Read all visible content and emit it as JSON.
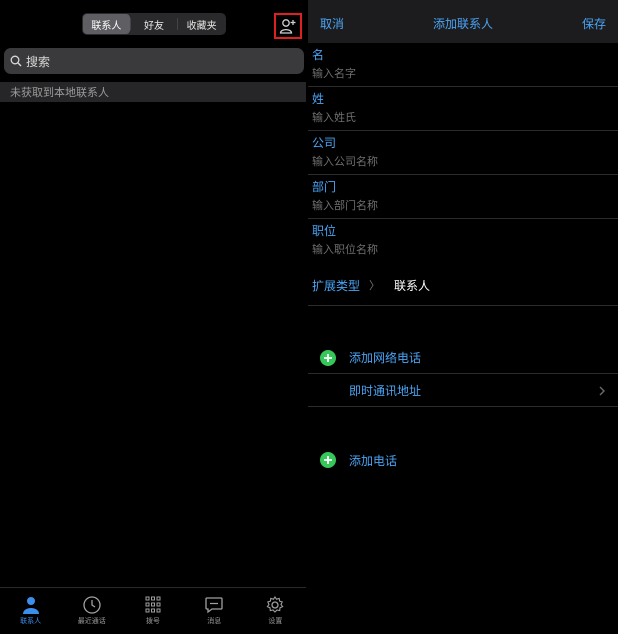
{
  "left": {
    "segments": [
      {
        "label": "联系人",
        "active": true
      },
      {
        "label": "好友",
        "active": false
      },
      {
        "label": "收藏夹",
        "active": false
      }
    ],
    "search_placeholder": "搜索",
    "notice": "未获取到本地联系人",
    "tabs": [
      {
        "label": "联系人",
        "icon": "person-icon",
        "active": true
      },
      {
        "label": "最近通话",
        "icon": "clock-icon",
        "active": false
      },
      {
        "label": "拨号",
        "icon": "dialpad-icon",
        "active": false
      },
      {
        "label": "消息",
        "icon": "message-icon",
        "active": false
      },
      {
        "label": "设置",
        "icon": "gear-icon",
        "active": false
      }
    ]
  },
  "right": {
    "nav": {
      "cancel": "取消",
      "title": "添加联系人",
      "save": "保存"
    },
    "fields": [
      {
        "label": "名",
        "placeholder": "输入名字"
      },
      {
        "label": "姓",
        "placeholder": "输入姓氏"
      },
      {
        "label": "公司",
        "placeholder": "输入公司名称"
      },
      {
        "label": "部门",
        "placeholder": "输入部门名称"
      },
      {
        "label": "职位",
        "placeholder": "输入职位名称"
      }
    ],
    "ext": {
      "label": "扩展类型",
      "sep": "〉",
      "value": "联系人"
    },
    "add_network_phone": "添加网络电话",
    "im_address": "即时通讯地址",
    "add_phone": "添加电话"
  },
  "colors": {
    "accent": "#4aa3f3",
    "plus": "#35c759",
    "highlight": "#e02020"
  }
}
